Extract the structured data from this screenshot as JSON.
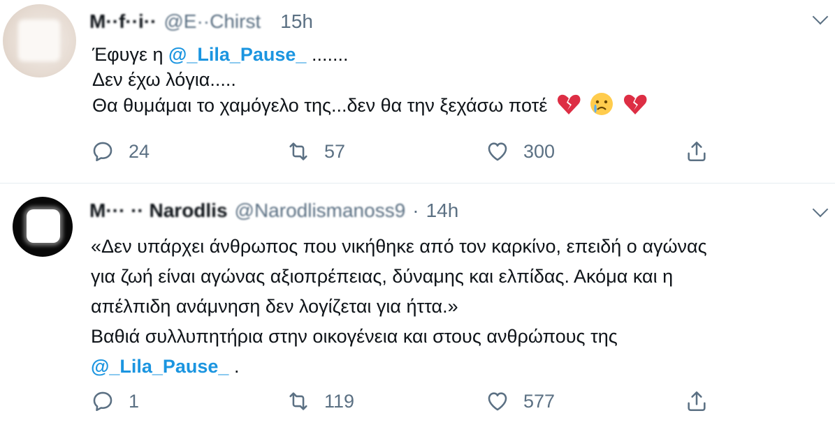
{
  "tweets": [
    {
      "name": "M··f··i··",
      "handle": "@E··Chirst",
      "time": "15h",
      "text": {
        "line1_prefix": "Έφυγε η ",
        "line1_mention": "@_Lila_Pause_",
        "line1_suffix": " .......",
        "line2": "Δεν έχω λόγια.....",
        "line3": "Θα θυμάμαι το χαμόγελο της...δεν θα την ξεχάσω ποτέ",
        "emojis": [
          "broken-heart-icon",
          "crying-face-icon",
          "broken-heart-icon"
        ]
      },
      "stats": {
        "replies": "24",
        "retweets": "57",
        "likes": "300"
      }
    },
    {
      "name": "M··· ·· Narodlis",
      "handle": "@Narodlismanoss9",
      "dot": "·",
      "time": "14h",
      "text": {
        "line1": "«Δεν υπάρχει άνθρωπος που νικήθηκε από τον καρκίνο, επειδή ο αγώνας",
        "line2": "για ζωή είναι αγώνας αξιοπρέπειας, δύναμης και ελπίδας. Ακόμα και η",
        "line3": "απέλπιδη ανάμνηση δεν λογίζεται για ήττα.»",
        "line4": "Βαθιά συλλυπητήρια στην οικογένεια και στους ανθρώπους της",
        "line5_mention": "@_Lila_Pause_",
        "line5_suffix": " ."
      },
      "stats": {
        "replies": "1",
        "retweets": "119",
        "likes": "577"
      }
    }
  ],
  "colors": {
    "accent": "#1b95e0",
    "muted": "#5b7083",
    "text": "#0f1419",
    "divider": "#e6ecf0",
    "heart": "#e0245e"
  }
}
